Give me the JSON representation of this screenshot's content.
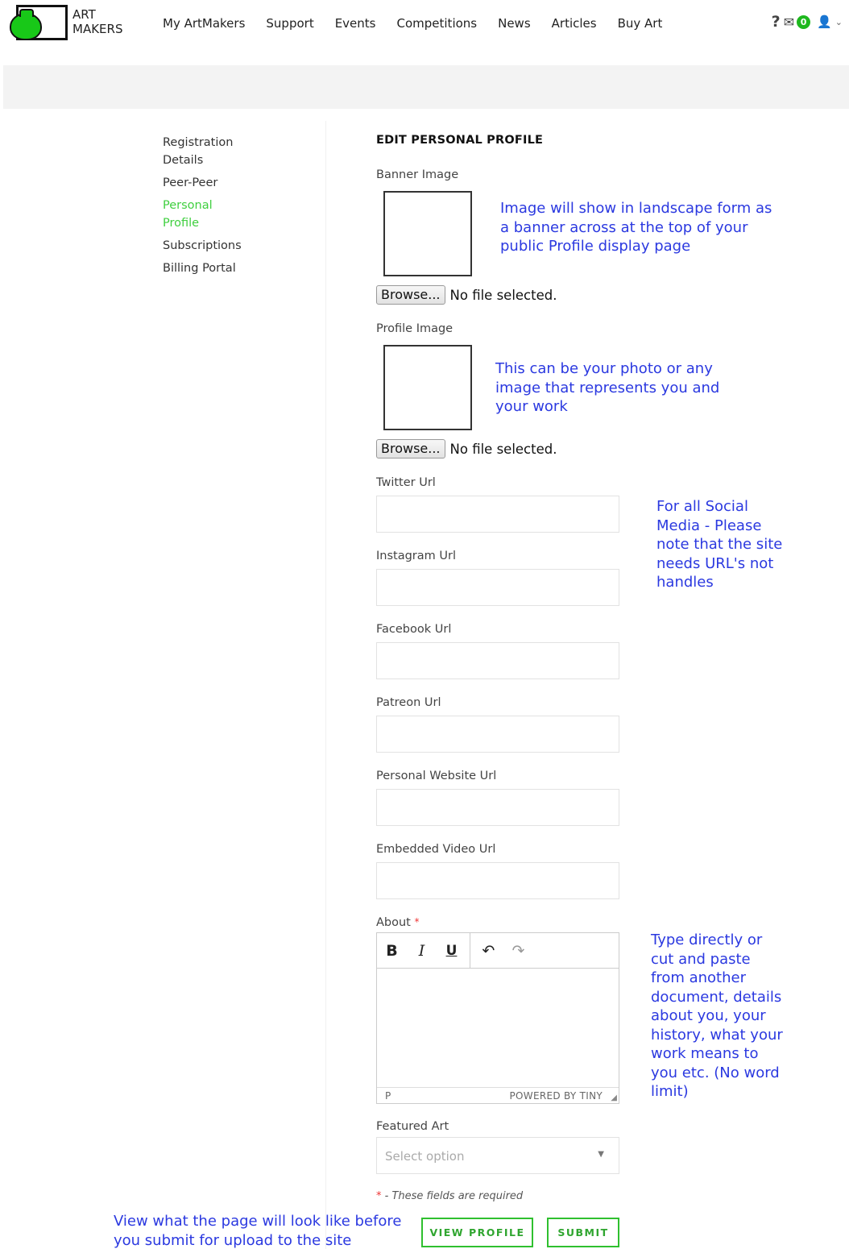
{
  "header": {
    "logo_line1": "ART",
    "logo_line2": "MAKERS",
    "nav": [
      "My ArtMakers",
      "Support",
      "Events",
      "Competitions",
      "News",
      "Articles",
      "Buy Art"
    ],
    "help_glyph": "?",
    "mail_glyph": "✉",
    "message_count": "0",
    "user_glyph": "👤",
    "chevron_glyph": "⌄"
  },
  "sidebar": {
    "items": [
      {
        "label": "Registration Details",
        "active": false
      },
      {
        "label": "Peer-Peer",
        "active": false
      },
      {
        "label": "Personal Profile",
        "active": true
      },
      {
        "label": "Subscriptions",
        "active": false
      },
      {
        "label": "Billing Portal",
        "active": false
      }
    ]
  },
  "form": {
    "title": "EDIT PERSONAL PROFILE",
    "banner_label": "Banner Image",
    "banner_note": "Image will show in landscape form as a banner across at the top of your public Profile display page",
    "profile_label": "Profile Image",
    "profile_note": "This can be your photo or any image that represents you and your work",
    "browse_label": "Browse...",
    "no_file_text": "No file selected.",
    "twitter_label": "Twitter Url",
    "instagram_label": "Instagram Url",
    "facebook_label": "Facebook Url",
    "patreon_label": "Patreon Url",
    "website_label": "Personal Website Url",
    "video_label": "Embedded Video Url",
    "social_note": "For all Social Media - Please note that the site needs  URL's not handles",
    "about_label": "About",
    "required_star": "*",
    "about_note": "Type directly or cut and paste from another document, details about you, your history, what your work means to you etc. (No word limit)",
    "editor": {
      "bold": "B",
      "italic": "I",
      "underline": "U",
      "undo": "↶",
      "redo": "↷",
      "path": "P",
      "powered": "POWERED BY TINY",
      "resize": "◢"
    },
    "featured_label": "Featured Art",
    "featured_placeholder": "Select option",
    "caret_glyph": "▼",
    "required_note": " - These fields are required",
    "view_note": "View what the page will look like before you submit for upload to the site",
    "view_button": "VIEW PROFILE",
    "submit_button": "SUBMIT"
  },
  "colors": {
    "accent_green": "#2fc02f",
    "note_blue": "#2b39e0",
    "active_green": "#3fcf3f"
  }
}
